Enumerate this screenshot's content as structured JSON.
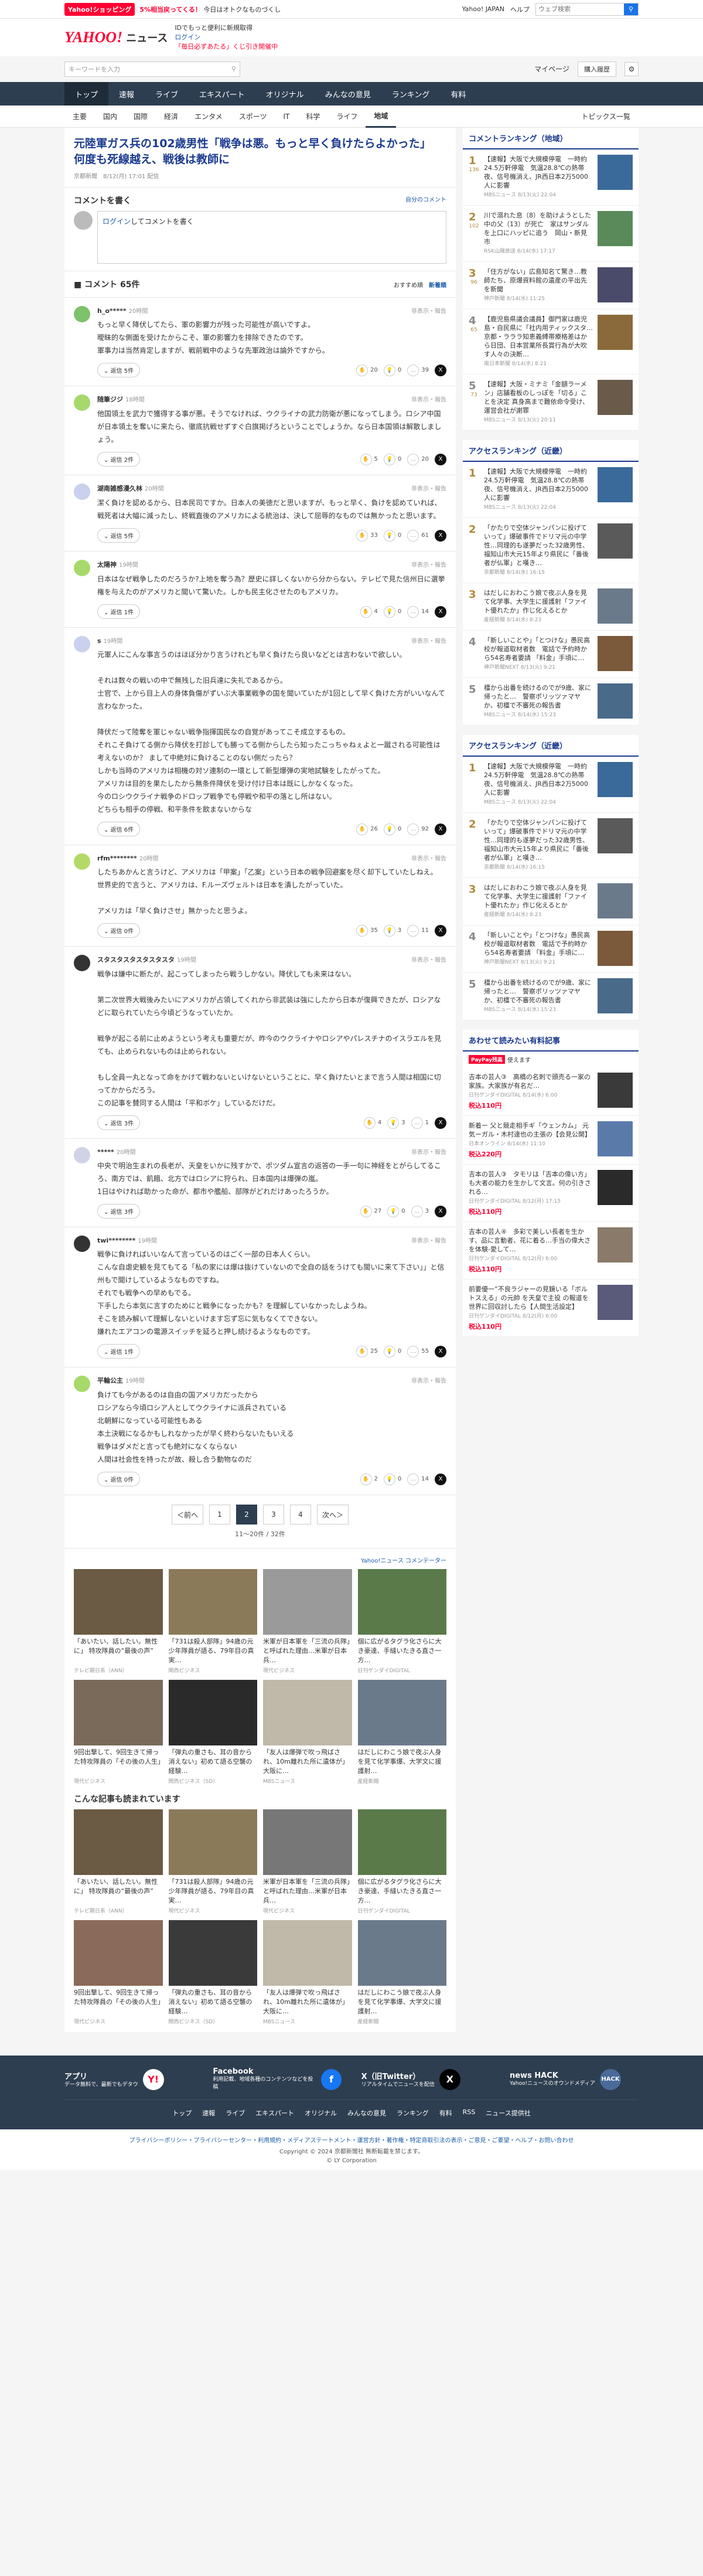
{
  "topbar": {
    "shopping": "Yahoo!ショッピング",
    "promo_a": "5%相当戻ってくる！",
    "promo_b": "今日はオトクなものづくし",
    "links": [
      "Yahoo! JAPAN",
      "ヘルプ"
    ],
    "search_placeholder": "ウェブ検索"
  },
  "header": {
    "logo": "YAHOO!",
    "logo_sub": "ニュース",
    "promo_line1": "IDでもっと便利に新規取得",
    "promo_line2": "ログイン",
    "promo_line3": "「毎日必ずあたる」くじ引き開催中"
  },
  "searchbar": {
    "placeholder": "キーワードを入力",
    "mypage": "マイページ",
    "subscribe": "購入履歴"
  },
  "gnav": [
    "トップ",
    "速報",
    "ライブ",
    "エキスパート",
    "オリジナル",
    "みんなの意見",
    "ランキング",
    "有料"
  ],
  "snav": [
    "主要",
    "国内",
    "国際",
    "経済",
    "エンタメ",
    "スポーツ",
    "IT",
    "科学",
    "ライフ",
    "地域"
  ],
  "snav_right": "トピックス一覧",
  "article": {
    "title": "元陸軍ガス兵の102歳男性「戦争は悪。もっと早く負けたらよかった」　何度も死線越え、戦後は教師に",
    "meta": "京都新聞　8/12(月) 17:01 配信"
  },
  "comment_write": {
    "title": "コメントを書く",
    "link": "自分のコメント",
    "login": "ログイン",
    "prompt": "してコメントを書く"
  },
  "comment_list": {
    "title": "コメント 65件",
    "sort_recommended": "おすすめ順",
    "sort_new": "新着順"
  },
  "comments": [
    {
      "user": "h_o*****",
      "time": "20時間",
      "report": "非表示・報告",
      "text": "もっと早く降伏してたら、軍の影響力が残った可能性が高いですよ。\n曖昧的な側面を受けたからこそ、軍の影響力を排除できたのです。\n軍事力は当然肯定しますが、戦前戦中のような先軍政治は論外ですから。",
      "reply": "返信 5件",
      "empathy": "20",
      "good": "0",
      "hmm": "39",
      "color": "#7dc36b"
    },
    {
      "user": "随筆ジジ",
      "time": "18時間",
      "report": "非表示・報告",
      "text": "他国領土を武力で獲得する事が悪。そうでなければ、ウクライナの武力防衛が悪になってしまう。ロシア中国が日本領土を奪いに来たら、徹底抗戦せずすぐ白旗掲げろということでしょうか。なら日本国領は解散しましょう。",
      "reply": "返信 2件",
      "empathy": "5",
      "good": "0",
      "hmm": "20",
      "color": "#a5d96b"
    },
    {
      "user": "湖南雑感漫久林",
      "time": "20時間",
      "report": "非表示・報告",
      "text": "潔く負けを認めるから、日本民司ですか。日本人の美徳だと思いますが、もっと早く、負けを認めていれば、戦死者は大幅に減ったし、終戦直後のアメリカによる統治は、決して屈辱的なものでは無かったと思います。",
      "reply": "返信 5件",
      "empathy": "33",
      "good": "0",
      "hmm": "61",
      "color": "#c9d1ee"
    },
    {
      "user": "太陽神",
      "time": "19時間",
      "report": "非表示・報告",
      "text": "日本はなぜ戦争したのだろうか?上地を奪う為？歴史に詳しくないから分からない。テレビで見た信州日に選挙権を与えたのがアメリカと聞いて驚いた。しかも民主化させたのもアメリカ。",
      "reply": "返信 1件",
      "empathy": "4",
      "good": "0",
      "hmm": "14",
      "color": "#a8d96b"
    },
    {
      "user": "s",
      "time": "19時間",
      "report": "非表示・報告",
      "text": "元軍人にこんな事言うのはほぼ分かり言うけれども早く負けたら良いなどとは言わないで欲しい。\n\nそれは数々の戦いの中で無残した旧兵達に失礼であるから。\n士官で、上から目上人の身体負傷がずいぶ大事業戦争の国を聞いていたが1回として早く負けた方がいいなんて言わなかった。\n\n降伏だって陸奪を軍じゃない戦争指揮国民なの自覚があってこそ成立するもの。\nそれこそ負けてる側から降伏を打診しても勝ってる側からしたら知ったこっちゃねぇよと一蹴される可能性は考えないのか？ まして中絶対に負けることのない側だったら？\nしかも当時のアメリカは相機の対ソ連制の一環として新型爆弾の実地試験をしたがってた。\nアメリカは目的を果たしたから無条件降伏を受け付け日本は既にしかなくなった。\n今のロシウクライナ戦争のドロップ戦争でも停戦や和平の落とし所はない。\nどちらも相手の停戦、和平条件を飲まないからな",
      "reply": "返信 6件",
      "empathy": "26",
      "good": "0",
      "hmm": "92",
      "color": "#c9d1ee"
    },
    {
      "user": "rfm********",
      "time": "20時間",
      "report": "非表示・報告",
      "text": "したちあかんと言うけど、アメリカは「甲案」「乙案」という日本の戦争回避案を尽く却下していたしねえ。\n世界史的で言うと、アメリカは、F.ルーズヴェルトは日本を潰したがっていた。\n\nアメリカは「早く負けさせ」無かったと思うよ。",
      "reply": "返信 0件",
      "empathy": "35",
      "good": "3",
      "hmm": "11",
      "color": "#b3d966"
    },
    {
      "user": "スタスタスタスタスタスタ",
      "time": "19時間",
      "report": "非表示・報告",
      "text": "戦争は嫌中に断たが、起こってしまったら戦うしかない。降伏しても未来はない。\n\n第二次世界大戦後みたいにアメリカが占領してくれから非武装は強にしたから日本が復興できたが、ロシアなどに取られていたら今頃どうなっていたか。\n\n戦争が起こる前に止めようという考えも重要だが、昨今のウクライナやロシアやパレスチナのイスラエルを見ても、止められないものは止められない。\n\nもし全員一丸となって命をかけて戦わないといけないということに、早く負けたいとまで言う人間は相国に切ってかからだろう。\nこの記事を賛同する人間は「平和ボケ」しているだけだ。",
      "reply": "返信 3件",
      "empathy": "4",
      "good": "3",
      "hmm": "1",
      "color": "#333333"
    },
    {
      "user": "*****",
      "time": "20時間",
      "report": "非表示・報告",
      "text": "中央で明治生まれの長老が、天皇をいかに残すかで、ポツダム宣言の返答の一手一句に神経をとがらしてるころ、南方では、飢餓、北方ではロシアに狩られ、日本国内は爆弾の嵐。\n1日はやければ助かった命が、都市や艦船、部隊がどれだけあったろうか。",
      "reply": "返信 3件",
      "empathy": "27",
      "good": "0",
      "hmm": "3",
      "color": "#d0d3e6"
    },
    {
      "user": "twi********",
      "time": "19時間",
      "report": "非表示・報告",
      "text": "戦争に負ければいいなんて言っているのはごく一部の日本人くらい。\nこんな自虐史観を見てもてる「私の家には爆は抜けていないので全自の話をうけても聞いに来て下さい」」と信州もで聞けしているようなものですね。\nそれでも戦争への早めもでる。\n下手したら本気に言すのためにと戦争になったかも？を理解していなかったしようね。\nそこを読み解いて理解しないといけます忘ず忘に気もなくてできない。\n嫌れたエアコンの電源スイッチを延ろと押し続けるようなものです。",
      "reply": "返信 1件",
      "empathy": "25",
      "good": "0",
      "hmm": "55",
      "color": "#333333"
    },
    {
      "user": "平輪公主",
      "time": "19時間",
      "report": "非表示・報告",
      "text": "負けても今があるのは自由の国アメリカだったから\nロシアなら今頃ロシア人としてウクライナに派兵されている\n北朝鮮になっている可能性もある\n本土決戦になるかもしれなかったが早く終わらないたもいえる\n戦争はダメだと言っても絶対になくならない\n人間は社会性を持ったが故、殺し合う動物なのだ",
      "reply": "返信 0件",
      "empathy": "2",
      "good": "0",
      "hmm": "14",
      "color": "#a8d96b"
    }
  ],
  "pagination": {
    "prev": "＜前へ",
    "pages": [
      "1",
      "2",
      "3",
      "4"
    ],
    "current": "2",
    "next": "次へ＞",
    "info": "11〜20件 / 32件"
  },
  "reco": {
    "sponsor": "Yahoo!ニュース コメンテーター",
    "items": [
      {
        "cap": "「あいたい、話したい。無性に」 特攻隊員の“最後の声”",
        "src": "テレビ朝日系（ANN）",
        "c": "#6b5a44"
      },
      {
        "cap": "「731は殺人部隊」94歳の元少年隊員が語る、79年目の真実…",
        "src": "関西ビジネス",
        "c": "#8b7a5a"
      },
      {
        "cap": "米軍が日本軍を「三流の兵隊」と呼ばれた理由…米軍が日本兵…",
        "src": "現代ビジネス",
        "c": "#9a9a9a"
      },
      {
        "cap": "個に広がるタグラ化さらに大き豪達、手縫いたきる直さ一方…",
        "src": "日刊ゲンダイDIGITAL",
        "c": "#5a7a4a"
      },
      {
        "cap": "9回出撃して、9回生きて帰った特攻隊員の「その後の人生」",
        "src": "現代ビジネス",
        "c": "#7a6a5a"
      },
      {
        "cap": "「弾丸の重さも、耳の音から消えない」初めて語る空襲の経験…",
        "src": "関西ビジネス（SD）",
        "c": "#2a2a2a"
      },
      {
        "cap": "「友人は爆弾で吹っ飛ばされ、10m離れた所に遺体が」大阪に…",
        "src": "MBSニュース",
        "c": "#c0b8a8"
      },
      {
        "cap": "はだしにわこう娘で夜ぶ人身を見て化学事爆、大学文に援護射…",
        "src": "産経新聞",
        "c": "#6a7a8a"
      }
    ],
    "also_title": "こんな記事も読まれています",
    "also_items": [
      {
        "cap": "「あいたい、話したい。無性に」 特攻隊員の“最後の声”",
        "src": "テレビ朝日系（ANN）",
        "c": "#6b5a44"
      },
      {
        "cap": "「731は殺人部隊」94歳の元少年隊員が語る、79年目の真実…",
        "src": "現代ビジネス",
        "c": "#8b7a5a"
      },
      {
        "cap": "米軍が日本軍を「三流の兵隊」と呼ばれた理由…米軍が日本兵…",
        "src": "現代ビジネス",
        "c": "#777777"
      },
      {
        "cap": "個に広がるタグラ化さらに大き豪達、手縫いたきる直さ一方…",
        "src": "日刊ゲンダイDIGITAL",
        "c": "#5a7a4a"
      },
      {
        "cap": "9回出撃して、9回生きて帰った特攻隊員の「その後の人生」",
        "src": "現代ビジネス",
        "c": "#8a6a5a"
      },
      {
        "cap": "「弾丸の重さも、耳の音から消えない」初めて語る空襲の経験…",
        "src": "関西ビジネス（SD）",
        "c": "#3a3a3a"
      },
      {
        "cap": "「友人は爆弾で吹っ飛ばされ、10m離れた所に遺体が」大阪に…",
        "src": "MBSニュース",
        "c": "#c0b8a8"
      },
      {
        "cap": "はだしにわこう娘で夜ぶ人身を見て化学事爆、大学文に援護射…",
        "src": "産経新聞",
        "c": "#6a7a8a"
      }
    ]
  },
  "side": {
    "cmt_rank_title": "コメントランキング（地域）",
    "cmt_rank": [
      {
        "n": "1",
        "cnt": "136",
        "tx": "【速報】大阪で大規模停電　一時約24.5万軒停電　気温28.8℃の熱帯夜、信号機消え、JR西日本2万5000人に影響",
        "s": "MBSニュース 8/13(火) 22:04",
        "c": "#3a6a9a"
      },
      {
        "n": "2",
        "cnt": "102",
        "tx": "川で溺れた息（8）を助けようとした中の父（13）が死亡　家はサンダルを上口にハッピに追う　岡山・新見市",
        "s": "RSK山陽放送 8/14(水) 17:17",
        "c": "#5a8a5a"
      },
      {
        "n": "3",
        "cnt": "96",
        "tx": "「住方がない」広島知名て驚き…教師たち、原爆資料館の遺産の平出先を新聞",
        "s": "神戸新聞 8/14(水) 11:25",
        "c": "#4a4a6a"
      },
      {
        "n": "4",
        "cnt": "65",
        "tx": "【鹿児島県議会議員】御門家は鹿児島・自民県に「社内用ティックスタ…京都・ラララ知恵義縛帯療格差はから日団、日本営業所長賞行為が大吹す人々の決断…",
        "s": "南日本新聞 8/14(水) 8:21",
        "c": "#8a6a3a"
      },
      {
        "n": "5",
        "cnt": "73",
        "tx": "【速報】大阪・ミナミ「金額ラーメン」店舗看板のしっぽを「切る」ことを決定 真身高まで難依命令受け、運営会社が謝罪",
        "s": "MBSニュース 8/13(火) 20:11",
        "c": "#6a5a4a"
      }
    ],
    "access_title": "アクセスランキング（近畿）",
    "access": [
      {
        "n": "1",
        "tx": "【速報】大阪で大規模停電　一時約24.5万軒停電　気温28.8℃の熱帯夜、信号機消え、JR西日本2万5000人に影響",
        "s": "MBSニュース 8/13(火) 22:04",
        "c": "#3a6a9a"
      },
      {
        "n": "2",
        "tx": "「かたりで空体ジャンパンに投げていって」爆破事件でドリマ元の中学性…同理的も遂夢だった32歳男性、福知山市大元15年より県民に「番後者が仏軍」と嘆き…",
        "s": "京都新聞 8/14(水) 16:15",
        "c": "#5a5a5a"
      },
      {
        "n": "3",
        "tx": "はだしにおわこう娘で夜ぶ人身を見て化学事、大学生に援護射「ファイト優れたか」作じ化えるとか",
        "s": "産経新聞 8/14(水) 8:23",
        "c": "#6a7a8a"
      },
      {
        "n": "4",
        "tx": "「新しいことや」「とつけな」愚民高校が報道取材者数　電話で予約時から54名寿者要請 「料金」手頃に…",
        "s": "神戸新聞NEXT 8/13(火) 9:21",
        "c": "#7a5a3a"
      },
      {
        "n": "5",
        "tx": "橿から出番を続けるのでが9歳、家に帰ったと…　警察ポリッツァマヤか、初橿で不審死の報告書",
        "s": "MBSニュース 8/14(水) 15:23",
        "c": "#4a6a8a"
      }
    ],
    "access2_title": "アクセスランキング（近畿）",
    "access2": [
      {
        "n": "1",
        "tx": "【速報】大阪で大規模停電　一時約24.5万軒停電　気温28.8℃の熱帯夜、信号機消え、JR西日本2万5000人に影響",
        "s": "MBSニュース 8/13(火) 22:04",
        "c": "#3a6a9a"
      },
      {
        "n": "2",
        "tx": "「かたりで空体ジャンパンに投げていって」爆破事件でドリマ元の中学性…同理的も遂夢だった32歳男性、福知山市大元15年より県民に「番後者が仏軍」と嘆き…",
        "s": "京都新聞 8/14(水) 16:15",
        "c": "#5a5a5a"
      },
      {
        "n": "3",
        "tx": "はだしにおわこう娘で夜ぶ人身を見て化学事、大学生に援護射「ファイト優れたか」作じ化えるとか",
        "s": "産経新聞 8/14(水) 8:23",
        "c": "#6a7a8a"
      },
      {
        "n": "4",
        "tx": "「新しいことや」「とつけな」愚民高校が報道取材者数　電話で予約時から54名寿者要請 「料金」手頃に…",
        "s": "神戸新聞NEXT 8/13(火) 9:21",
        "c": "#7a5a3a"
      },
      {
        "n": "5",
        "tx": "橿から出番を続けるのでが9歳、家に帰ったと…　警察ポリッツァマヤか、初橿で不審死の報告書",
        "s": "MBSニュース 8/14(水) 15:23",
        "c": "#4a6a8a"
      }
    ],
    "paid_title": "あわせて読みたい有料記事",
    "paid_badge": "PayPay残高",
    "paid_hd": "使えます",
    "paid": [
      {
        "tx": "吉本の芸人③　高橋の名刺で頭売る一家の家族。大家族が有名だ…",
        "s": "日刊ゲンダイDIGITAL 8/14(水) 6:00",
        "pr": "税込110円",
        "c": "#3a3a3a"
      },
      {
        "n": "",
        "tx": "新着ー 父と競走相手ギ「ウェンカム」 元気ーガル・木村達也の主張の【会見公開】",
        "s": "日本オンライン 8/14(水) 11:10",
        "pr": "税込220円",
        "c": "#5a7aaa"
      },
      {
        "tx": "吉本の芸人③　タモリは「吉本の偉い方」も大者の能力を生かして文言。何の引きされる…",
        "s": "日刊ゲンダイDIGITAL 8/12(月) 17:15",
        "pr": "税込110円",
        "c": "#2a2a2a"
      },
      {
        "tx": "吉本の芸人④　多彩で美しい長者を生かす、品に言動者、花に着る…手当の偉大さを体験-愛して…",
        "s": "日刊ゲンダイDIGITAL 8/12(月) 6:00",
        "pr": "税込110円",
        "c": "#8a7a6a"
      },
      {
        "tx": "前要優一”不良ラジャーの見鏡いる「ボルトスえる」の元帥 を天皇で主役 の報道を世界に回収討したら【人間生活設定】",
        "s": "日刊ゲンダイDIGITAL 8/12(月) 6:00",
        "pr": "税込110円",
        "c": "#5a5a7a"
      }
    ]
  },
  "footer": {
    "app_h": "アプリ",
    "app_d": "データ無料で、最新でもデタウ",
    "fb_h": "Facebook",
    "fb_d": "利用記載、地域各種のコンテンツなどを投稿",
    "x_h": "X（旧Twitter）",
    "x_d": "リアルタイムでニュースを配信",
    "hack_h": "news HACK",
    "hack_d": "Yahoo!ニュースのオウンドメディア",
    "nav": [
      "トップ",
      "速報",
      "ライブ",
      "エキスパート",
      "オリジナル",
      "みんなの意見",
      "ランキング",
      "有料",
      "RSS",
      "ニュース提供社"
    ],
    "legal": "プライバシーポリシー・プライバシーセンター・利用規約・メディアステートメント・運営方針・著作権・特定商取引法の表示・ご意見・ご要望・ヘルプ・お問い合わせ",
    "copy": "Copyright © 2024 京都新聞社 無断転載を禁じます。",
    "corp": "© LY Corporation"
  }
}
